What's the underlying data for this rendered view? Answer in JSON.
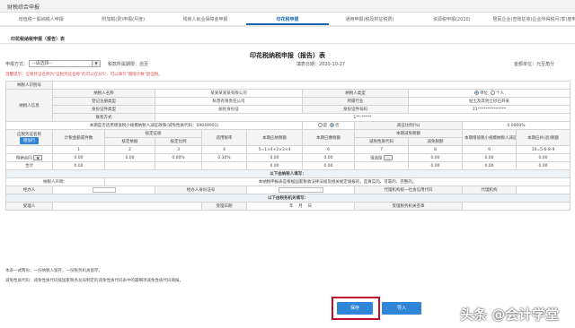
{
  "app_title": "财税综合申报",
  "tabs": [
    "增值税一般纳税人申报",
    "附加税(费)申报(月度)",
    "残疾人就业保障金申报",
    "印花税申报",
    "通用申报(税及附征税费)",
    "资源税申报(2020)",
    "居民企业(查账征收)企业所得税月(季)度申报"
  ],
  "active_tab": 3,
  "subhead": "印花税纳税申报（报告）表",
  "form_title": "印花税纳税申报（报告）表",
  "meta": {
    "period_label": "申报方式：",
    "select_value": "--请选择--",
    "tax_period_label": "税款所属期限：自至",
    "fill_date": "填表日期：2020-10-27",
    "amount_unit": "金额单位：元至角分"
  },
  "notice": "温馨提示：应税凭证名称为\"征税凭证名称\"的可以在分贝，可以填写\"期限计数\"后征税。",
  "rows": {
    "taxpayer_id_label": "纳税人识别号",
    "taxpayer_info_label": "纳税人信息",
    "name_label": "纳税人名称",
    "name_value": "某某某某某有限公司",
    "taxpayer_type_label": "纳税人类型",
    "unit_label": "单位",
    "person_label": "个人",
    "reg_type_label": "登记注册类型",
    "reg_type_value": "私营有限责任公司",
    "industry_label": "所属行业",
    "industry_value": "帖土及其他土砂石开采",
    "id_type_label": "身份证件类型",
    "id_type_value": "居民身份证",
    "id_no_label": "身份证件号码",
    "id_no_value": "21**************",
    "contact_label": "联系方式",
    "contact_value": "1**-*****",
    "small_scale_q": "本期是否适用增值税小规模纳税人减征政策(减免性质代码：09049901)",
    "yes_label": "是",
    "no_label": "否",
    "reduce_ratio_label": "减征比例(%)",
    "reduce_ratio_value": "0.0000%",
    "voucher_label": "应税凭证名称",
    "add_btn": "增加行",
    "col_monthly_amount": "计税金额或件数",
    "col_verified": "核定征收",
    "col_basis": "核定依据",
    "col_ratio": "核定比例",
    "col_rate": "适用税率",
    "col_payable": "本期应纳税额",
    "col_paid": "本期已缴税额",
    "col_reduction": "本期减免税额",
    "col_reduce_code": "减免性质代码",
    "col_reduce_amount": "减免税额",
    "col_small_scale": "本期增值税小规模纳税人减征额",
    "col_refund": "本期应补(退)税额",
    "idx": [
      "1",
      "2",
      "3",
      "4",
      "5=1×4+2×3×4",
      "6",
      "7",
      "8",
      "9",
      "10=5-6-8-9"
    ],
    "contract_name": "购销合同",
    "v1": "0.00",
    "v2": "0.00",
    "v3": "0.00%",
    "v4": "0.30%",
    "v5": "0.00",
    "v6": "0.00",
    "select_please": "请选择",
    "v8": "0.00",
    "v9": "0.00",
    "v10": "0.00",
    "total_label": "合计",
    "t1": "0.00",
    "t5": "0.00",
    "t6": "0.00",
    "t8": "0.00",
    "t9": "0.00",
    "t10": "0.00",
    "sec_taxpayer": "以下由纳税人填写：",
    "declare_label": "纳税人声明：",
    "declare_text": "本纳税申报表是根据国家税收法律法规及相关规定填报的，是真实的、可靠的、完整的。",
    "handler_label": "经办人",
    "handler_id_label": "经办人身份证号",
    "agent_code_label": "代理机构统一社会信用代码",
    "agent_label": "代理机构",
    "sec_tax_office": "以下由税务机关填写：",
    "receiver_label": "受理人",
    "receive_date_label": "受理日期",
    "year": "年",
    "month": "月",
    "day": "日",
    "seal_label": "受理税务机关签章"
  },
  "footnote1": "本表一式两份，一份纳税人留存，一份税务机关留存。",
  "footnote2": "减免性质代码：减免性质代码按国家税务总局制定的减免性质代码表中的最细项减免性质代码填报。",
  "save_button": "保存",
  "import_button": "导入",
  "watermark": "头条 @会计学堂"
}
